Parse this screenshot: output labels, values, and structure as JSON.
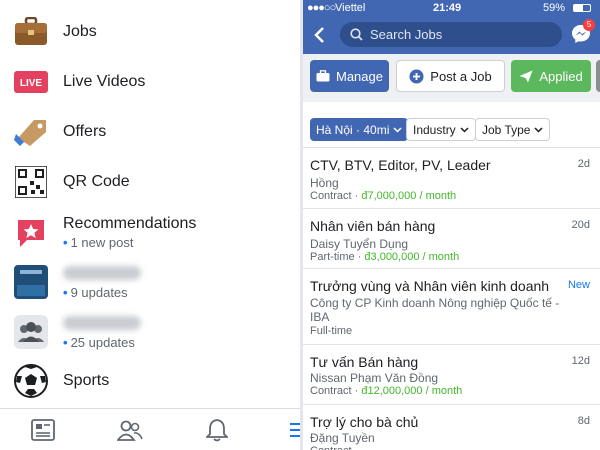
{
  "left_menu": {
    "items": [
      {
        "label": "Jobs",
        "icon": "briefcase-icon"
      },
      {
        "label": "Live Videos",
        "icon": "live-icon",
        "badge": "LIVE"
      },
      {
        "label": "Offers",
        "icon": "offer-tag-icon"
      },
      {
        "label": "QR Code",
        "icon": "qr-code-icon"
      },
      {
        "label": "Recommendations",
        "icon": "recommendations-icon",
        "sub": "1 new post"
      },
      {
        "label": "",
        "icon": "group-avatar-icon",
        "sub": "9 updates",
        "blurred": true
      },
      {
        "label": "",
        "icon": "group-people-icon",
        "sub": "25 updates",
        "blurred": true
      },
      {
        "label": "Sports",
        "icon": "soccer-ball-icon"
      }
    ],
    "bottom_nav": [
      "news-feed-icon",
      "friends-icon",
      "notifications-icon"
    ]
  },
  "status_bar": {
    "carrier": "Viettel",
    "time": "21:49",
    "battery": "59%"
  },
  "header": {
    "search_placeholder": "Search Jobs",
    "messenger_badge": "5"
  },
  "action_buttons": {
    "manage": "Manage",
    "post": "Post a Job",
    "applied": "Applied"
  },
  "filters": {
    "location": "Hà Nội · 40mi",
    "industry": "Industry",
    "job_type": "Job Type"
  },
  "jobs": [
    {
      "title": "CTV, BTV, Editor, PV, Leader",
      "company": "Hồng",
      "type": "Contract",
      "salary": "đ7,000,000 / month",
      "age": "2d"
    },
    {
      "title": "Nhân viên bán hàng",
      "company": "Daisy Tuyển Dụng",
      "type": "Part-time",
      "salary": "đ3,000,000 / month",
      "age": "20d"
    },
    {
      "title": "Trưởng vùng và Nhân viên kinh doanh",
      "company": "Công ty CP Kinh doanh Nông nghiệp Quốc tế -",
      "company_line2": "IBA",
      "type": "Full-time",
      "salary": "",
      "age": "New"
    },
    {
      "title": "Tư vấn Bán hàng",
      "company": "Nissan Phạm Văn Đồng",
      "type": "Contract",
      "salary": "đ12,000,000 / month",
      "age": "12d"
    },
    {
      "title": "Trợ lý cho bà chủ",
      "company": "Đặng Tuyền",
      "type": "Contract",
      "salary": "",
      "age": "8d"
    }
  ],
  "colors": {
    "brand": "#4267b2",
    "applied": "#5cb85c",
    "salary": "#42b72a",
    "accent": "#1877f2"
  }
}
